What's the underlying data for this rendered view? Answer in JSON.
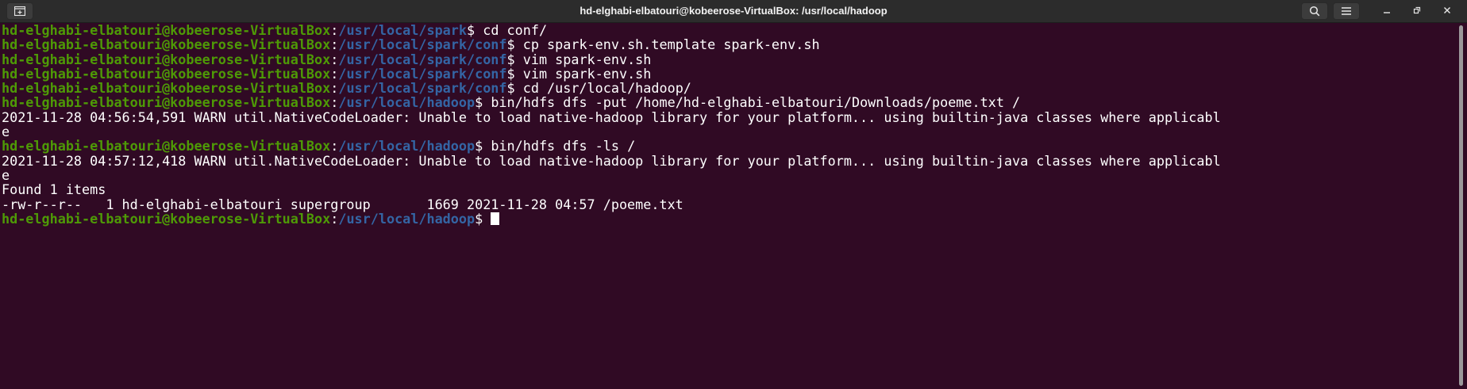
{
  "window": {
    "title": "hd-elghabi-elbatouri@kobeerose-VirtualBox: /usr/local/hadoop",
    "buttons": {
      "new_tab_icon": "new-tab-icon",
      "search_icon": "search-icon",
      "menu_icon": "hamburger-menu-icon",
      "minimize_icon": "minimize-icon",
      "maximize_icon": "maximize-icon",
      "close_icon": "close-icon"
    }
  },
  "colors": {
    "background": "#300a24",
    "user": "#4e9a06",
    "path": "#3465a4",
    "text": "#ffffff"
  },
  "terminal": {
    "prompt_user": "hd-elghabi-elbatouri@kobeerose-VirtualBox",
    "lines": [
      {
        "type": "cmd",
        "path": "/usr/local/spark",
        "command": "cd conf/"
      },
      {
        "type": "cmd",
        "path": "/usr/local/spark/conf",
        "command": "cp spark-env.sh.template spark-env.sh"
      },
      {
        "type": "cmd",
        "path": "/usr/local/spark/conf",
        "command": "vim spark-env.sh"
      },
      {
        "type": "cmd",
        "path": "/usr/local/spark/conf",
        "command": "vim spark-env.sh"
      },
      {
        "type": "cmd",
        "path": "/usr/local/spark/conf",
        "command": "cd /usr/local/hadoop/"
      },
      {
        "type": "cmd",
        "path": "/usr/local/hadoop",
        "command": "bin/hdfs dfs -put /home/hd-elghabi-elbatouri/Downloads/poeme.txt /"
      },
      {
        "type": "out",
        "text": "2021-11-28 04:56:54,591 WARN util.NativeCodeLoader: Unable to load native-hadoop library for your platform... using builtin-java classes where applicabl"
      },
      {
        "type": "out",
        "text": "e"
      },
      {
        "type": "cmd",
        "path": "/usr/local/hadoop",
        "command": "bin/hdfs dfs -ls /"
      },
      {
        "type": "out",
        "text": "2021-11-28 04:57:12,418 WARN util.NativeCodeLoader: Unable to load native-hadoop library for your platform... using builtin-java classes where applicabl"
      },
      {
        "type": "out",
        "text": "e"
      },
      {
        "type": "out",
        "text": "Found 1 items"
      },
      {
        "type": "out",
        "text": "-rw-r--r--   1 hd-elghabi-elbatouri supergroup       1669 2021-11-28 04:57 /poeme.txt"
      },
      {
        "type": "cmd",
        "path": "/usr/local/hadoop",
        "command": "",
        "cursor": true
      }
    ]
  }
}
